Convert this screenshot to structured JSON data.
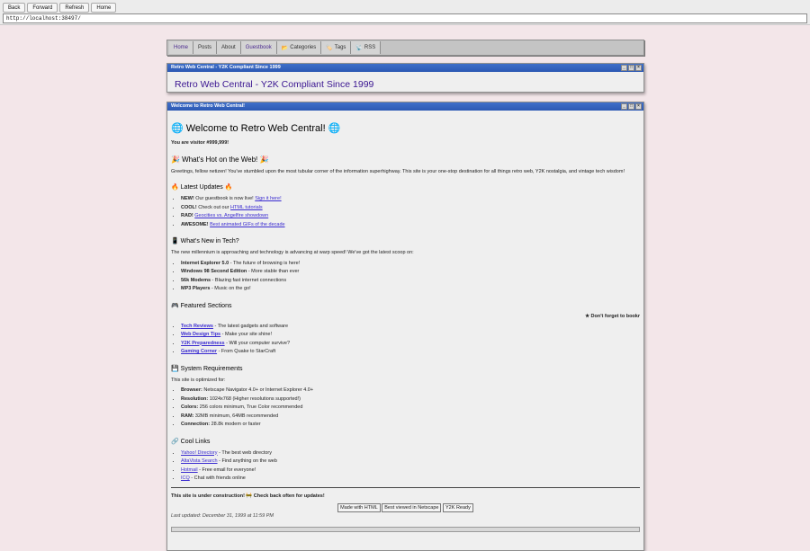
{
  "browser": {
    "buttons": [
      "Back",
      "Forward",
      "Refresh",
      "Home"
    ],
    "url": "http://localhost:38497/"
  },
  "menu": [
    {
      "label": "Home",
      "icon": ""
    },
    {
      "label": "Posts",
      "icon": ""
    },
    {
      "label": "About",
      "icon": ""
    },
    {
      "label": "Guestbook",
      "icon": ""
    },
    {
      "label": "Categories",
      "icon": "📂"
    },
    {
      "label": "Tags",
      "icon": "🏷️"
    },
    {
      "label": "RSS",
      "icon": "📡"
    }
  ],
  "header_window": {
    "title": "Retro Web Central - Y2K Compliant Since 1999",
    "heading": "Retro Web Central - Y2K Compliant Since 1999"
  },
  "main_window": {
    "title": "Welcome to Retro Web Central!",
    "welcome_heading": "🌐 Welcome to Retro Web Central! 🌐",
    "visitor": "You are visitor #999,999!",
    "hot_heading": "🎉 What's Hot on the Web! 🎉",
    "hot_text": "Greetings, fellow netizen! You've stumbled upon the most tubular corner of the information superhighway. This site is your one-stop destination for all things retro web, Y2K nostalgia, and vintage tech wisdom!",
    "updates_heading": "🔥 Latest Updates 🔥",
    "updates": [
      {
        "bold": "NEW!",
        "text": "Our guestbook is now live!",
        "link": "Sign it here!"
      },
      {
        "bold": "COOL!",
        "text": "Check out our",
        "link": "HTML tutorials"
      },
      {
        "bold": "RAD!",
        "text": "",
        "link": "Geocities vs. Angelfire showdown"
      },
      {
        "bold": "AWESOME!",
        "text": "",
        "link": "Best animated GIFs of the decade"
      }
    ],
    "tech_heading": "📱 What's New in Tech?",
    "tech_text": "The new millennium is approaching and technology is advancing at warp speed! We've got the latest scoop on:",
    "tech_items": [
      {
        "bold": "Internet Explorer 5.0",
        "text": " - The future of browsing is here!"
      },
      {
        "bold": "Windows 98 Second Edition",
        "text": " - More stable than ever"
      },
      {
        "bold": "56k Modems",
        "text": " - Blazing fast internet connections"
      },
      {
        "bold": "MP3 Players",
        "text": " - Music on the go!"
      }
    ],
    "featured_heading": "🎮 Featured Sections",
    "marquee": "★ Don't forget to bookr",
    "featured": [
      {
        "link": "Tech Reviews",
        "text": " - The latest gadgets and software"
      },
      {
        "link": "Web Design Tips",
        "text": " - Make your site shine!"
      },
      {
        "link": "Y2K Preparedness",
        "text": " - Will your computer survive?"
      },
      {
        "link": "Gaming Corner",
        "text": " - From Quake to StarCraft"
      }
    ],
    "sysreq_heading": "💾 System Requirements",
    "sysreq_text": "This site is optimized for:",
    "sysreq": [
      {
        "bold": "Browser:",
        "text": " Netscape Navigator 4.0+ or Internet Explorer 4.0+"
      },
      {
        "bold": "Resolution:",
        "text": " 1024x768 (Higher resolutions supported!)"
      },
      {
        "bold": "Colors:",
        "text": " 256 colors minimum, True Color recommended"
      },
      {
        "bold": "RAM:",
        "text": " 32MB minimum, 64MB recommended"
      },
      {
        "bold": "Connection:",
        "text": " 28.8k modem or faster"
      }
    ],
    "links_heading": "🔗 Cool Links",
    "links": [
      {
        "link": "Yahoo! Directory",
        "text": " - The best web directory"
      },
      {
        "link": "AltaVista Search",
        "text": " - Find anything on the web"
      },
      {
        "link": "Hotmail",
        "text": " - Free email for everyone!"
      },
      {
        "link": "ICQ",
        "text": " - Chat with friends online"
      }
    ],
    "construction": "This site is under construction! 🚧 Check back often for updates!",
    "badges": [
      "Made with HTML",
      "Best viewed in Netscape",
      "Y2K Ready"
    ],
    "last_updated": "Last updated: December 31, 1999 at 11:59 PM"
  }
}
